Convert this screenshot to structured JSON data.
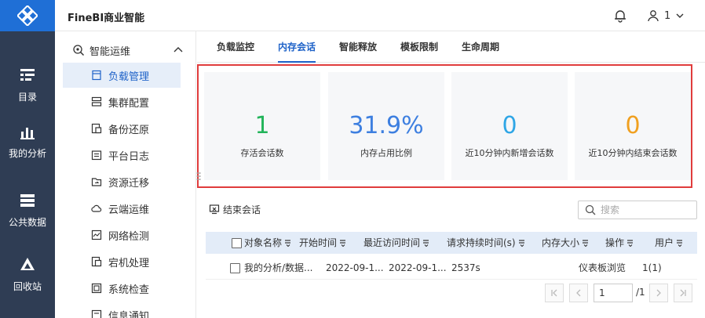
{
  "app": {
    "title": "FineBI商业智能"
  },
  "header": {
    "user_label": "1"
  },
  "rail": {
    "items": [
      {
        "label": "目录",
        "icon": "catalog-icon"
      },
      {
        "label": "我的分析",
        "icon": "analysis-chart-icon"
      },
      {
        "label": "公共数据",
        "icon": "database-icon"
      },
      {
        "label": "回收站",
        "icon": "recycle-icon"
      }
    ]
  },
  "sidebar": {
    "group_label": "智能运维",
    "items": [
      {
        "label": "负载管理",
        "active": true
      },
      {
        "label": "集群配置"
      },
      {
        "label": "备份还原"
      },
      {
        "label": "平台日志"
      },
      {
        "label": "资源迁移"
      },
      {
        "label": "云端运维"
      },
      {
        "label": "网络检测"
      },
      {
        "label": "宕机处理"
      },
      {
        "label": "系统检查"
      },
      {
        "label": "信息通知"
      }
    ]
  },
  "tabs": [
    {
      "label": "负载监控"
    },
    {
      "label": "内存会话",
      "active": true
    },
    {
      "label": "智能释放"
    },
    {
      "label": "模板限制"
    },
    {
      "label": "生命周期"
    }
  ],
  "metrics": [
    {
      "value": "1",
      "label": "存活会话数",
      "color": "#22b45a"
    },
    {
      "value": "31.9%",
      "label": "内存占用比例",
      "color": "#3d7fe0"
    },
    {
      "value": "0",
      "label": "近10分钟内新增会话数",
      "color": "#2fa6e6"
    },
    {
      "value": "0",
      "label": "近10分钟内结束会话数",
      "color": "#f0a020"
    }
  ],
  "toolbar": {
    "end_session_label": "结束会话",
    "search_placeholder": "搜索"
  },
  "table": {
    "columns": [
      "对象名称",
      "开始时间",
      "最近访问时间",
      "请求持续时间(s)",
      "内存大小",
      "操作",
      "用户"
    ],
    "rows": [
      {
        "name": "我的分析/数据...",
        "start": "2022-09-1...",
        "last_access": "2022-09-1...",
        "duration": "2537s",
        "memory": "",
        "operation": "仪表板浏览",
        "user": "1(1)"
      }
    ]
  },
  "pagination": {
    "current_page": "1",
    "total_label": "/1"
  }
}
